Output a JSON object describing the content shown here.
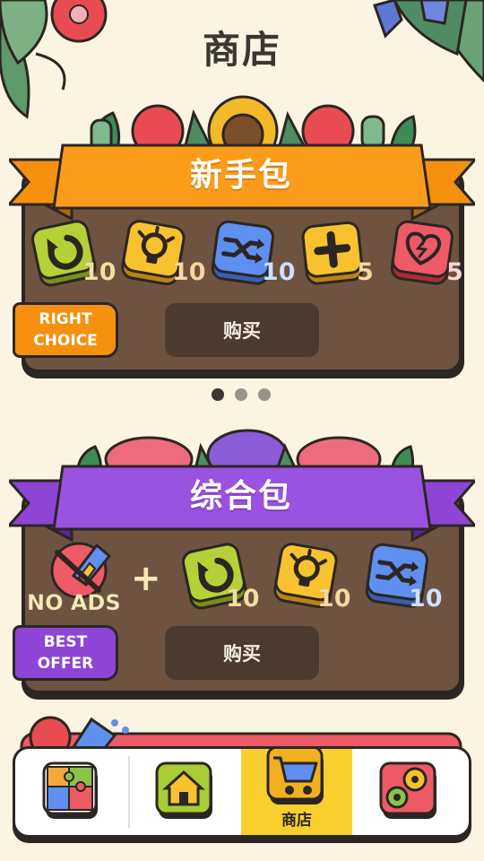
{
  "page": {
    "title": "商店"
  },
  "colors": {
    "background": "#fbf4e3",
    "board": "#6e5340",
    "ribbon_starter": "#f6900f",
    "ribbon_bundle": "#8e45d6",
    "buy_button": "#4a3a30",
    "nav_active": "#f9cf2e"
  },
  "packs": [
    {
      "name": "新手包",
      "tag_lines": [
        "RIGHT",
        "CHOICE"
      ],
      "buy_label": "购买",
      "items": [
        {
          "icon": "undo-icon",
          "count": "10"
        },
        {
          "icon": "hint-bulb-icon",
          "count": "10"
        },
        {
          "icon": "shuffle-icon",
          "count": "10"
        },
        {
          "icon": "add-icon",
          "count": "5"
        },
        {
          "icon": "heart-icon",
          "count": "5"
        }
      ]
    },
    {
      "name": "综合包",
      "tag_lines": [
        "BEST",
        "OFFER"
      ],
      "buy_label": "购买",
      "no_ads_label": "NO ADS",
      "plus": "+",
      "items": [
        {
          "icon": "undo-icon",
          "count": "10"
        },
        {
          "icon": "hint-bulb-icon",
          "count": "10"
        },
        {
          "icon": "shuffle-icon",
          "count": "10"
        }
      ]
    }
  ],
  "pagination": {
    "total": 3,
    "active": 0
  },
  "nav": {
    "items": [
      {
        "icon": "puzzle-icon",
        "label": ""
      },
      {
        "icon": "home-icon",
        "label": ""
      },
      {
        "icon": "shop-cart-icon",
        "label": "商店",
        "active": true
      },
      {
        "icon": "gears-icon",
        "label": ""
      }
    ]
  }
}
